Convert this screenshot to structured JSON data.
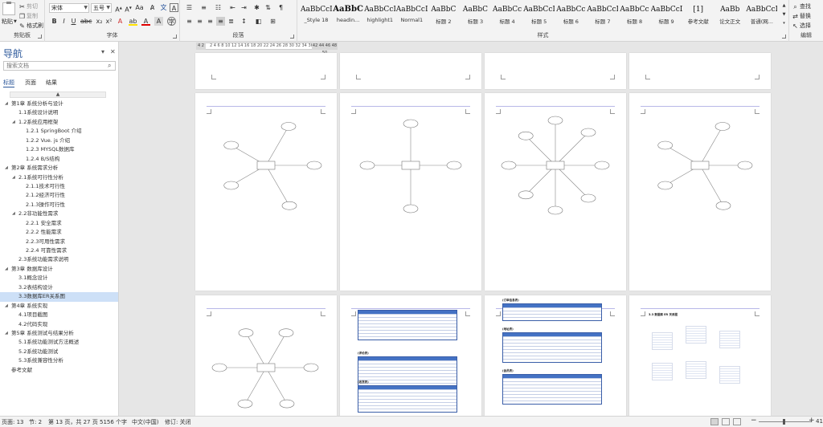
{
  "ribbon": {
    "clipboard": {
      "paste": "粘贴",
      "cut": "剪切",
      "copy": "复制",
      "format_painter": "格式刷",
      "group_label": "剪贴板"
    },
    "font": {
      "font_name": "宋体",
      "font_size": "五号",
      "group_label": "字体"
    },
    "paragraph": {
      "group_label": "段落"
    },
    "styles": {
      "items": [
        {
          "sample": "AaBbCcI",
          "name": "_Style 18"
        },
        {
          "sample": "AaBbC",
          "name": "headin..."
        },
        {
          "sample": "AaBbCcD",
          "name": "highlight1"
        },
        {
          "sample": "AaBbCcDi",
          "name": "Normal1"
        },
        {
          "sample": "AaBbC",
          "name": "标题 2"
        },
        {
          "sample": "AaBbC",
          "name": "标题 3"
        },
        {
          "sample": "AaBbCc",
          "name": "标题 4"
        },
        {
          "sample": "AaBbCcI",
          "name": "标题 5"
        },
        {
          "sample": "AaBbCc",
          "name": "标题 6"
        },
        {
          "sample": "AaBbCcI",
          "name": "标题 7"
        },
        {
          "sample": "AaBbCc",
          "name": "标题 8"
        },
        {
          "sample": "AaBbCcD",
          "name": "标题 9"
        },
        {
          "sample": "[1]",
          "name": "参考文献"
        },
        {
          "sample": "AaBb",
          "name": "论文正文"
        },
        {
          "sample": "AaBbCcI",
          "name": "普通(网..."
        }
      ],
      "group_label": "样式"
    },
    "editing": {
      "find": "查找",
      "replace": "替换",
      "select": "选择",
      "group_label": "编辑"
    }
  },
  "nav": {
    "title": "导航",
    "search_placeholder": "搜索文档",
    "tabs": [
      "标题",
      "页面",
      "结果"
    ],
    "tree": [
      {
        "label": "第1章 系统分析与设计",
        "level": 1,
        "expanded": true
      },
      {
        "label": "1.1系统设计说明",
        "level": 2
      },
      {
        "label": "1.2系统应用框架",
        "level": 2,
        "expanded": true
      },
      {
        "label": "1.2.1 SpringBoot 介绍",
        "level": 3
      },
      {
        "label": "1.2.2 Vue. js 介绍",
        "level": 3
      },
      {
        "label": "1.2.3 MYSQL数据库",
        "level": 3
      },
      {
        "label": "1.2.4 B/S结构",
        "level": 3
      },
      {
        "label": "第2章 系统需求分析",
        "level": 1,
        "expanded": true
      },
      {
        "label": "2.1系统可行性分析",
        "level": 2,
        "expanded": true
      },
      {
        "label": "2.1.1技术可行性",
        "level": 3
      },
      {
        "label": "2.1.2经济可行性",
        "level": 3
      },
      {
        "label": "2.1.3操作可行性",
        "level": 3
      },
      {
        "label": "2.2非功能性需求",
        "level": 2,
        "expanded": true
      },
      {
        "label": "2.2.1 安全需求",
        "level": 3
      },
      {
        "label": "2.2.2 性能需求",
        "level": 3
      },
      {
        "label": "2.2.3可用性需求",
        "level": 3
      },
      {
        "label": "2.2.4 可靠性需求",
        "level": 3
      },
      {
        "label": "2.3系统功能需求说明",
        "level": 2
      },
      {
        "label": "第3章 数据库设计",
        "level": 1,
        "expanded": true
      },
      {
        "label": "3.1概念设计",
        "level": 2
      },
      {
        "label": "3.2表结构设计",
        "level": 2
      },
      {
        "label": "3.3数据库ER关系图",
        "level": 2,
        "selected": true
      },
      {
        "label": "第4章 系统实现",
        "level": 1,
        "expanded": true
      },
      {
        "label": "4.1项目截图",
        "level": 2
      },
      {
        "label": "4.2代码实现",
        "level": 2
      },
      {
        "label": "第5章 系统测试与结果分析",
        "level": 1,
        "expanded": true
      },
      {
        "label": "5.1系统功能测试方法概述",
        "level": 2
      },
      {
        "label": "5.2系统功能测试",
        "level": 2
      },
      {
        "label": "5.3系统兼容性分析",
        "level": 2
      },
      {
        "label": "参考文献",
        "level": 1
      }
    ]
  },
  "ruler": {
    "marker": "4  2",
    "ticks": "2  4  6  8  10 12 14 16 18 20 22 24 26 28 30 32 34 36 38",
    "end": "42 44 46 48 50"
  },
  "pages": {
    "mini_section_title": "3.3 数据库 ER 关系图",
    "table_captions": [
      "(评论表)",
      "(收货表)",
      "(订单信息表)",
      "(地址表)",
      "(会员表)"
    ]
  },
  "statusbar": {
    "page": "页面: 13",
    "section": "节: 2",
    "page_of": "第 13 页，共 27 页",
    "words": "5156 个字",
    "language": "中文(中国)",
    "track_changes": "修订: 关闭",
    "zoom_percent": "41"
  },
  "colors": {
    "accent": "#2b579a",
    "selection": "#cde0f7",
    "table_header": "#4472c4"
  }
}
